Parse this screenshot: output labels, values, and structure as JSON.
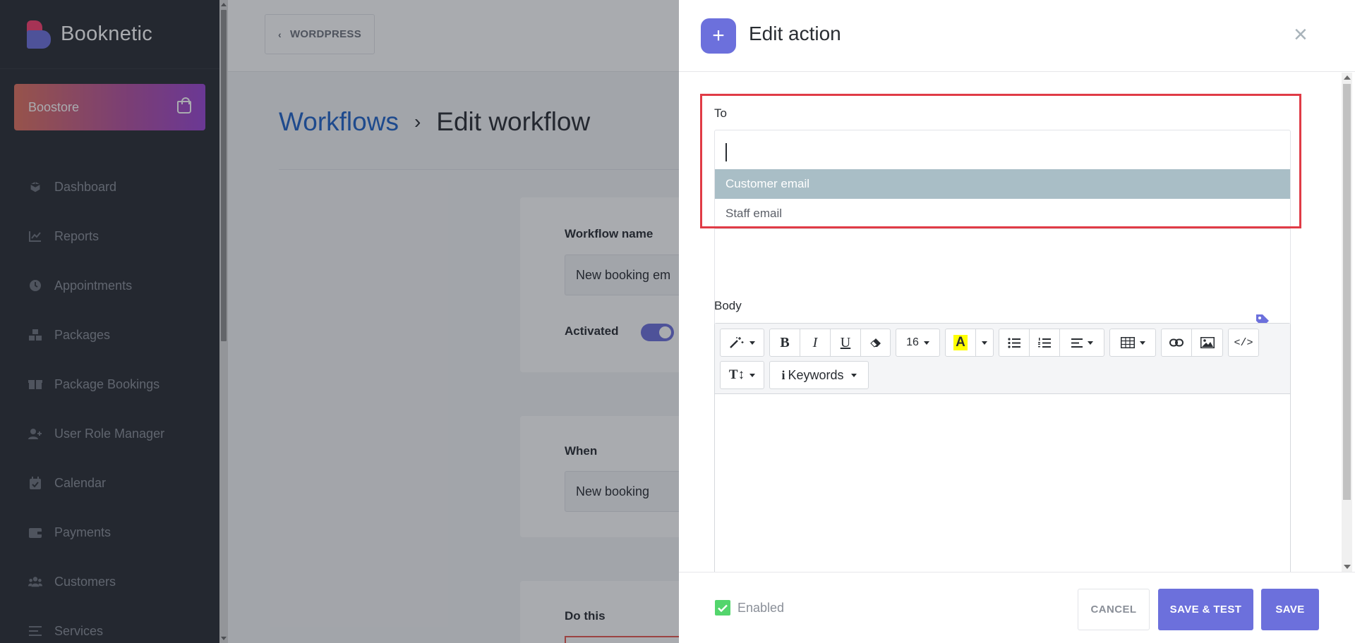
{
  "app": {
    "brand": "Booknetic",
    "boostore_label": "Boostore"
  },
  "sidebar": {
    "items": [
      {
        "label": "Dashboard",
        "icon": "cube-icon"
      },
      {
        "label": "Reports",
        "icon": "chart-line-icon"
      },
      {
        "label": "Appointments",
        "icon": "clock-icon"
      },
      {
        "label": "Packages",
        "icon": "boxes-icon"
      },
      {
        "label": "Package Bookings",
        "icon": "gift-box-icon"
      },
      {
        "label": "User Role Manager",
        "icon": "user-plus-icon"
      },
      {
        "label": "Calendar",
        "icon": "calendar-check-icon"
      },
      {
        "label": "Payments",
        "icon": "wallet-icon"
      },
      {
        "label": "Customers",
        "icon": "users-icon"
      },
      {
        "label": "Services",
        "icon": "list-icon"
      }
    ]
  },
  "topbar": {
    "wordpress_label": "WORDPRESS"
  },
  "breadcrumb": {
    "parent": "Workflows",
    "separator": "›",
    "current": "Edit workflow"
  },
  "workflow": {
    "name_label": "Workflow name",
    "name_value": "New booking em",
    "activated_label": "Activated",
    "activated": true,
    "when_label": "When",
    "when_value": "New booking",
    "do_this_label": "Do this"
  },
  "modal": {
    "title": "Edit action",
    "close_symbol": "×",
    "plus_symbol": "+",
    "to_label": "To",
    "to_value": "",
    "to_options": [
      {
        "label": "Customer email",
        "highlighted": true
      },
      {
        "label": "Staff email",
        "highlighted": false
      }
    ],
    "body_label": "Body",
    "toolbar": {
      "font_size": "16",
      "highlight_letter": "A",
      "code_label": "</>",
      "text_size_label": "T↕",
      "keywords_label": "Keywords",
      "info_symbol": "i"
    },
    "footer": {
      "enabled_label": "Enabled",
      "enabled": true,
      "cancel_label": "CANCEL",
      "save_test_label": "SAVE & TEST",
      "save_label": "SAVE"
    }
  },
  "colors": {
    "accent": "#6c70dc",
    "sidebar_bg": "#292d32",
    "highlight_option": "#a9bec6",
    "annotation_red": "#e03b46",
    "enabled_green": "#53d56c"
  }
}
